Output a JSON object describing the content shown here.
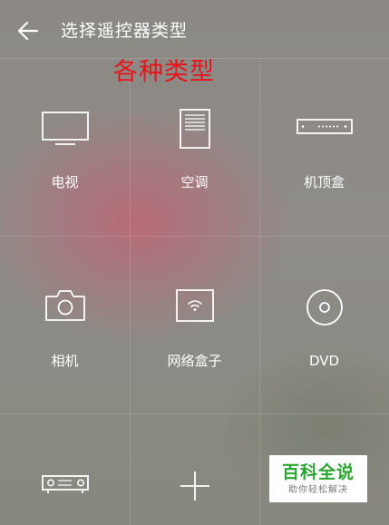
{
  "header": {
    "back_icon": "arrow-left-icon",
    "title": "选择遥控器类型"
  },
  "annotation": {
    "text": "各种类型",
    "color": "#e8141b"
  },
  "device_types": [
    {
      "label": "电视",
      "icon": "tv-icon"
    },
    {
      "label": "空调",
      "icon": "air-conditioner-icon"
    },
    {
      "label": "机顶盒",
      "icon": "set-top-box-icon"
    },
    {
      "label": "相机",
      "icon": "camera-icon"
    },
    {
      "label": "网络盒子",
      "icon": "network-box-icon"
    },
    {
      "label": "DVD",
      "icon": "dvd-icon"
    },
    {
      "label": "",
      "icon": "projector-icon"
    },
    {
      "label": "",
      "icon": "plus-icon"
    }
  ],
  "watermark": {
    "title": "百科全说",
    "subtitle": "助你轻松解决",
    "color": "#2aa52f"
  }
}
